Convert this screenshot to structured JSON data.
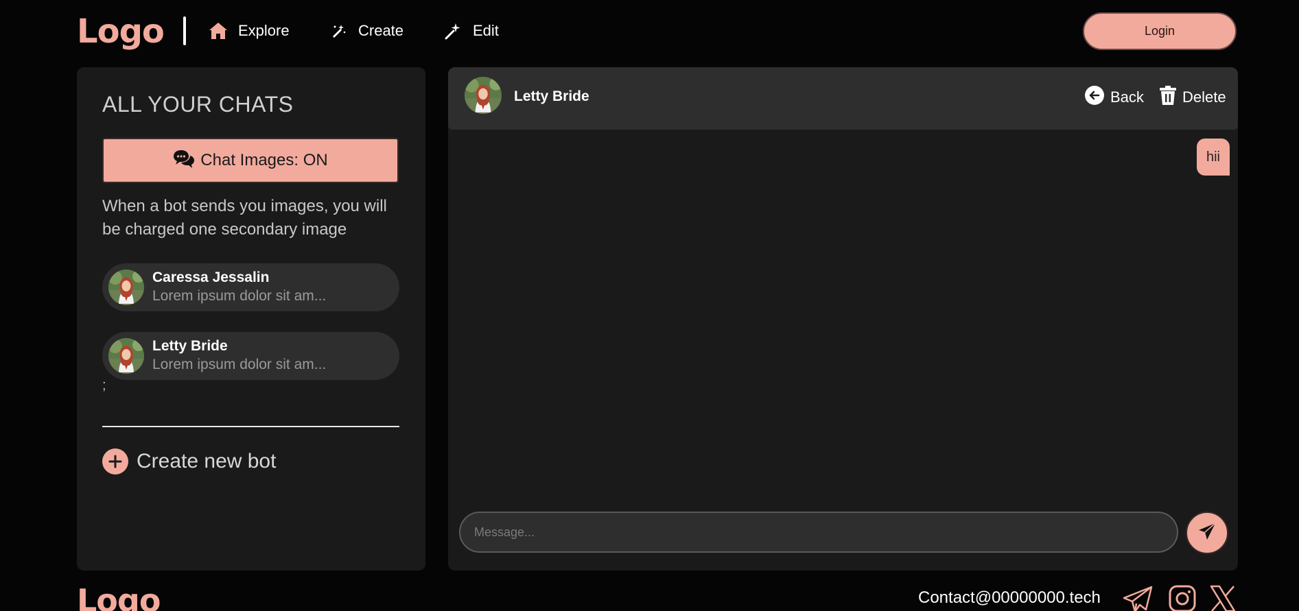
{
  "brand": {
    "logo_text": "Logo",
    "accent": "#f2aa9d"
  },
  "nav": {
    "items": [
      {
        "label": "Explore",
        "icon": "home-icon"
      },
      {
        "label": "Create",
        "icon": "magic-pen-icon"
      },
      {
        "label": "Edit",
        "icon": "magic-wand-icon"
      }
    ],
    "login_label": "Login"
  },
  "sidebar": {
    "title": "ALL YOUR CHATS",
    "images_toggle_label": "Chat Images: ON",
    "images_note": "When a bot sends you images, you will be charged one secondary image",
    "chats": [
      {
        "name": "Caressa Jessalin",
        "preview": "Lorem ipsum dolor sit am..."
      },
      {
        "name": "Letty Bride",
        "preview": "Lorem ipsum dolor sit am..."
      }
    ],
    "stray_text": ";",
    "create_bot_label": "Create new bot"
  },
  "chat": {
    "header_name": "Letty Bride",
    "back_label": "Back",
    "delete_label": "Delete",
    "messages": [
      {
        "from": "user",
        "text": "hii"
      }
    ],
    "input_placeholder": "Message..."
  },
  "footer": {
    "logo_text": "Logo",
    "contact": "Contact@00000000.tech",
    "social_icons": [
      "telegram-icon",
      "instagram-icon",
      "x-icon"
    ]
  }
}
